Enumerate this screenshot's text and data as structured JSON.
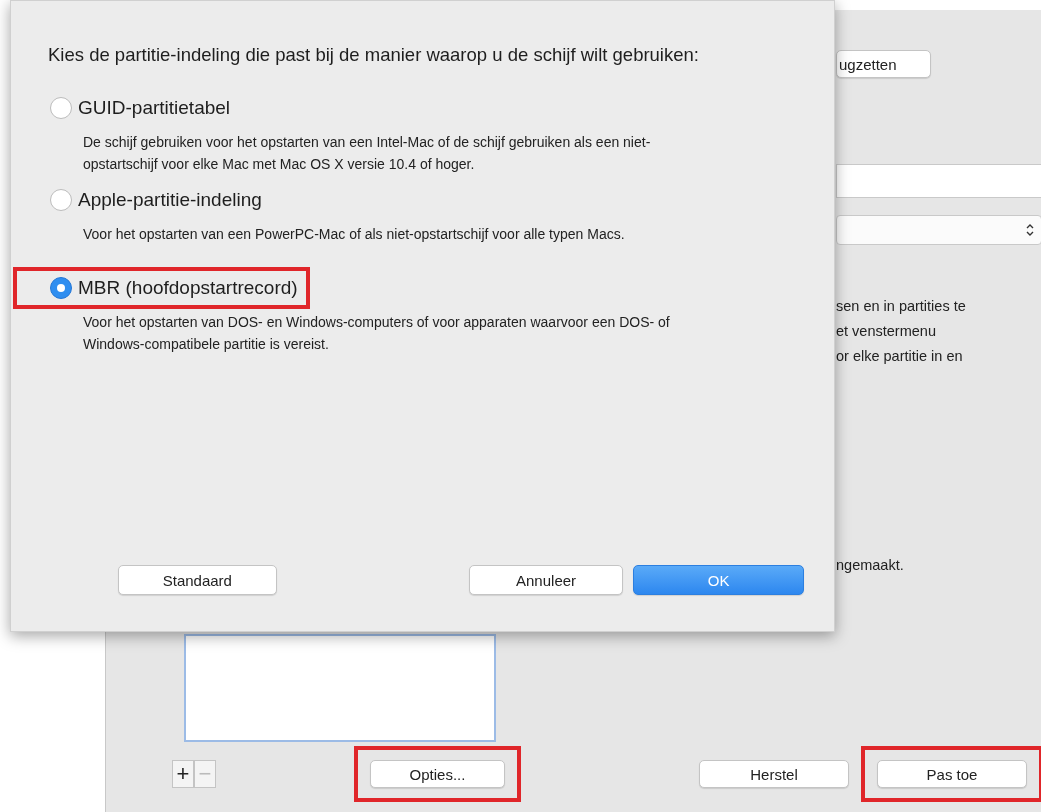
{
  "background": {
    "top_button": "ugzetten",
    "info_lines": [
      "sen en in partities te",
      "et venstermenu",
      "or elke partitie in en"
    ],
    "note": "ngemaakt.",
    "list_buttons": [
      {
        "label": "+",
        "disabled": false
      },
      {
        "label": "−",
        "disabled": true
      }
    ],
    "options_button": {
      "label": "Opties...",
      "highlighted": true
    },
    "buttons": [
      {
        "label": "Herstel",
        "highlighted": false
      },
      {
        "label": "Pas toe",
        "highlighted": true
      }
    ]
  },
  "dialog": {
    "prompt": "Kies de partitie-indeling die past bij de manier waarop u de schijf wilt gebruiken:",
    "options": [
      {
        "label": "GUID-partitietabel",
        "description": "De schijf gebruiken voor het opstarten van een Intel-Mac of de schijf gebruiken als een niet-opstartschijf voor elke Mac met Mac OS X versie 10.4 of hoger.",
        "selected": false,
        "highlighted": false
      },
      {
        "label": "Apple-partitie-indeling",
        "description": "Voor het opstarten van een PowerPC-Mac of als niet-opstartschijf voor alle typen Macs.",
        "selected": false,
        "highlighted": false
      },
      {
        "label": "MBR (hoofdopstartrecord)",
        "description": "Voor het opstarten van DOS- en Windows-computers of voor apparaten waarvoor een DOS- of Windows-compatibele partitie is vereist.",
        "selected": true,
        "highlighted": true
      }
    ],
    "buttons": [
      {
        "label": "Standaard",
        "kind": "plain"
      },
      {
        "label": "Annuleer",
        "kind": "plain"
      },
      {
        "label": "OK",
        "kind": "default"
      }
    ]
  }
}
